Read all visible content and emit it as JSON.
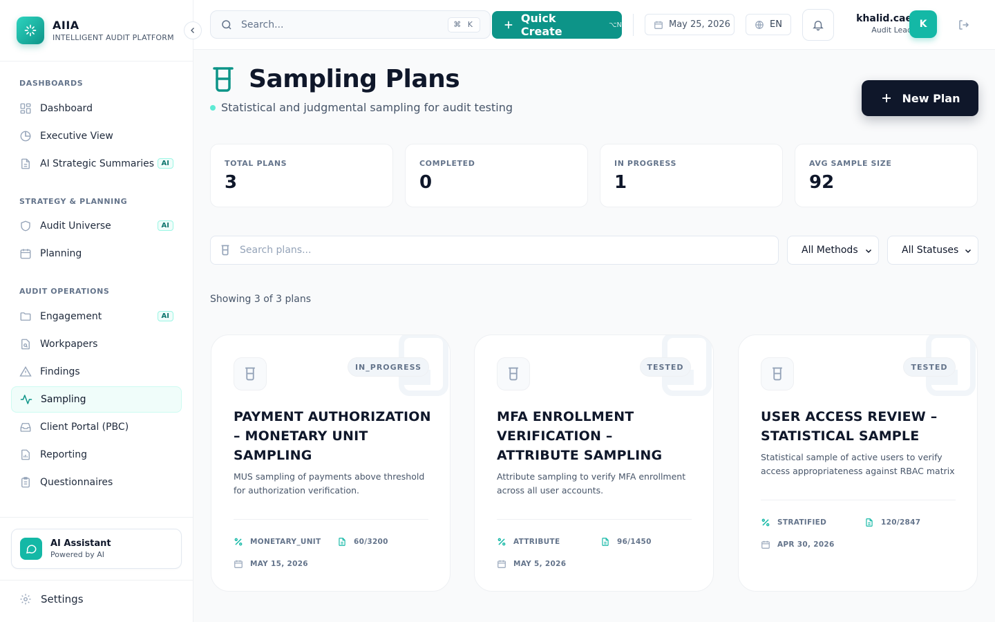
{
  "brand": {
    "name": "AIIA",
    "subtitle": "INTELLIGENT AUDIT PLATFORM"
  },
  "sidebar": {
    "sections": [
      {
        "label": "DASHBOARDS"
      },
      {
        "label": "STRATEGY & PLANNING"
      },
      {
        "label": "AUDIT OPERATIONS"
      }
    ],
    "items": [
      {
        "label": "Dashboard",
        "icon": "grid-icon"
      },
      {
        "label": "Executive View",
        "icon": "pie-chart-icon"
      },
      {
        "label": "AI Strategic Summaries",
        "icon": "document-icon",
        "badge": "AI"
      },
      {
        "label": "Audit Universe",
        "icon": "shield-icon",
        "badge": "AI"
      },
      {
        "label": "Planning",
        "icon": "calendar-icon"
      },
      {
        "label": "Engagement",
        "icon": "folder-icon",
        "badge": "AI"
      },
      {
        "label": "Workpapers",
        "icon": "file-search-icon"
      },
      {
        "label": "Findings",
        "icon": "warning-icon"
      },
      {
        "label": "Sampling",
        "icon": "activity-icon",
        "active": true
      },
      {
        "label": "Client Portal (PBC)",
        "icon": "inbox-icon"
      },
      {
        "label": "Reporting",
        "icon": "file-chart-icon"
      },
      {
        "label": "Questionnaires",
        "icon": "clipboard-icon"
      }
    ],
    "assistant": {
      "title": "AI Assistant",
      "subtitle": "Powered by AI"
    },
    "settings": "Settings"
  },
  "topbar": {
    "search_placeholder": "Search...",
    "search_shortcut": "⌘ K",
    "quick_create": "Quick Create",
    "quick_create_shortcut": "⌥N",
    "date": "May 25, 2026",
    "language": "EN",
    "user": {
      "name": "khalid.cae",
      "role": "Audit Lead",
      "initial": "K"
    }
  },
  "page": {
    "title": "Sampling Plans",
    "subtitle": "Statistical and judgmental sampling for audit testing",
    "new_plan": "New Plan"
  },
  "stats": [
    {
      "label": "TOTAL PLANS",
      "value": "3"
    },
    {
      "label": "COMPLETED",
      "value": "0"
    },
    {
      "label": "IN PROGRESS",
      "value": "1"
    },
    {
      "label": "AVG SAMPLE SIZE",
      "value": "92"
    }
  ],
  "filters": {
    "search_placeholder": "Search plans...",
    "method": "All Methods",
    "status": "All Statuses"
  },
  "showing": "Showing 3 of 3 plans",
  "plans": [
    {
      "status": "IN_PROGRESS",
      "title": "PAYMENT AUTHORIZATION – MONETARY UNIT SAMPLING",
      "description": "MUS sampling of payments above threshold for authorization verification.",
      "method": "MONETARY_UNIT",
      "sample": "60/3200",
      "date": "MAY 15, 2026"
    },
    {
      "status": "TESTED",
      "title": "MFA ENROLLMENT VERIFICATION – ATTRIBUTE SAMPLING",
      "description": "Attribute sampling to verify MFA enrollment across all user accounts.",
      "method": "ATTRIBUTE",
      "sample": "96/1450",
      "date": "MAY 5, 2026"
    },
    {
      "status": "TESTED",
      "title": "USER ACCESS REVIEW – STATISTICAL SAMPLE",
      "description": "Statistical sample of active users to verify access appropriateness against RBAC matrix and HR...",
      "method": "STRATIFIED",
      "sample": "120/2847",
      "date": "APR 30, 2026"
    }
  ],
  "colors": {
    "accent": "#0d9488",
    "accent_light": "#14b8a6",
    "dark": "#0f172a"
  }
}
